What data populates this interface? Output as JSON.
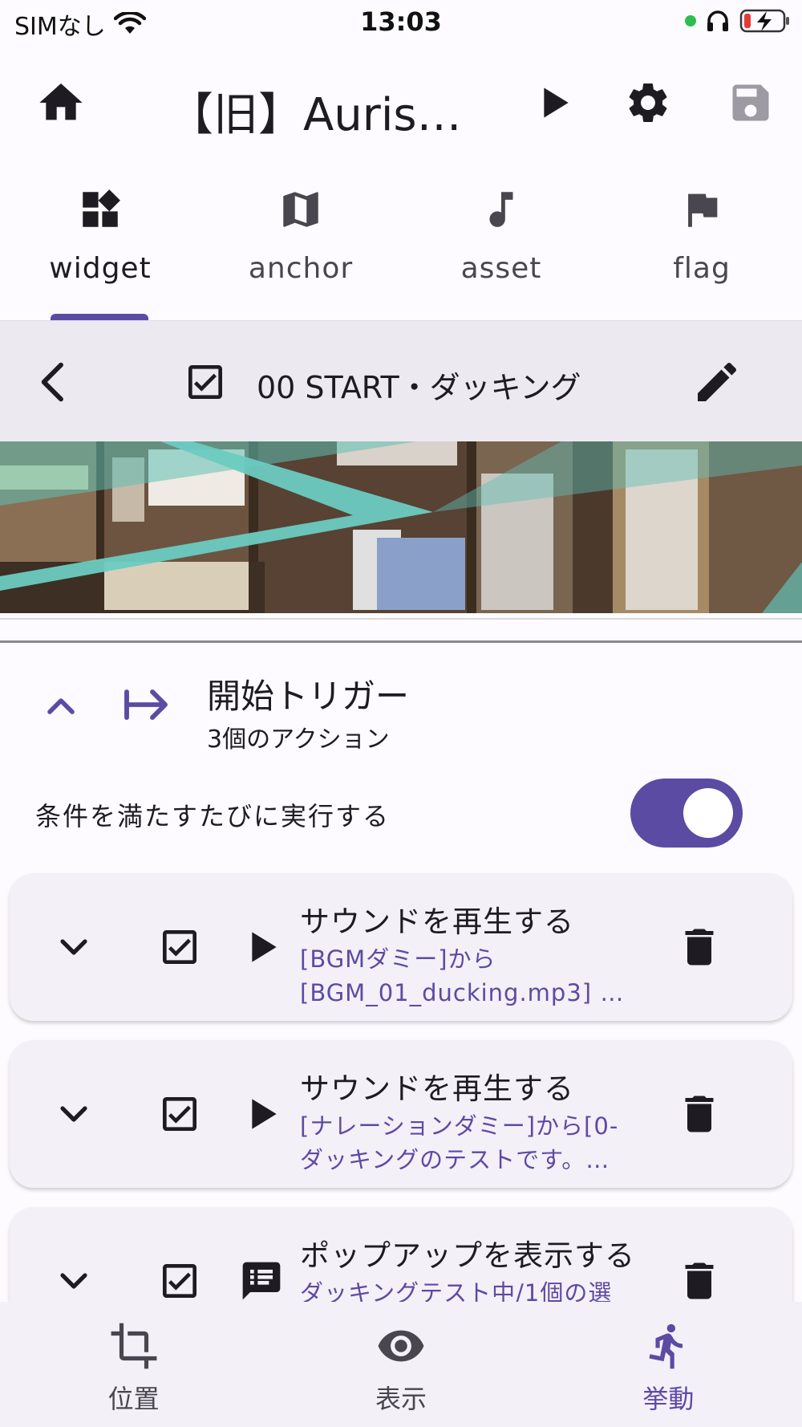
{
  "status": {
    "carrier": "SIMなし",
    "time": "13:03"
  },
  "app_bar": {
    "title": "【旧】Auris…"
  },
  "tabs": [
    {
      "label": "widget",
      "icon": "widgets-icon",
      "active": true
    },
    {
      "label": "anchor",
      "icon": "map-icon",
      "active": false
    },
    {
      "label": "asset",
      "icon": "music-note-icon",
      "active": false
    },
    {
      "label": "flag",
      "icon": "flag-icon",
      "active": false
    }
  ],
  "widget_header": {
    "title": "00 START・ダッキング",
    "enabled": true
  },
  "trigger": {
    "title": "開始トリガー",
    "subtitle": "3個のアクション",
    "repeat_label": "条件を満たすたびに実行する",
    "repeat_enabled": true
  },
  "actions": [
    {
      "title": "サウンドを再生する",
      "desc": "[BGMダミー]から\n[BGM_01_ducking.mp3] …",
      "type_icon": "play-icon",
      "checked": true
    },
    {
      "title": "サウンドを再生する",
      "desc": "[ナレーションダミー]から[0-\nダッキングのテストです。…",
      "type_icon": "play-icon",
      "checked": true
    },
    {
      "title": "ポップアップを表示する",
      "desc": "ダッキングテスト中/1個の選",
      "type_icon": "message-icon",
      "checked": true
    }
  ],
  "bottom_nav": [
    {
      "label": "位置",
      "icon": "crop-icon",
      "active": false
    },
    {
      "label": "表示",
      "icon": "eye-icon",
      "active": false
    },
    {
      "label": "挙動",
      "icon": "run-icon",
      "active": true
    }
  ],
  "colors": {
    "accent": "#5c4ba3",
    "card": "#f4f0f7",
    "header": "#ede9f1"
  }
}
